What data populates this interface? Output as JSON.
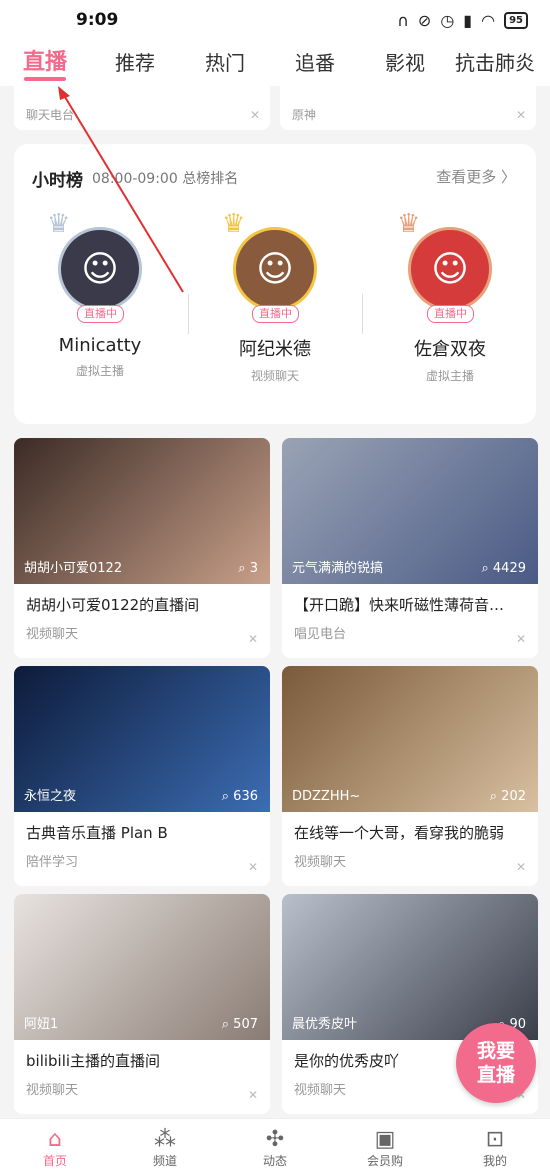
{
  "status": {
    "time": "9:09",
    "battery": "95"
  },
  "tabs": [
    {
      "label": "直播"
    },
    {
      "label": "推荐"
    },
    {
      "label": "热门"
    },
    {
      "label": "追番"
    },
    {
      "label": "影视"
    },
    {
      "label": "抗击肺炎"
    }
  ],
  "partial_cards": [
    {
      "category": "聊天电台"
    },
    {
      "category": "原神"
    }
  ],
  "rank": {
    "title": "小时榜",
    "subtitle": "08:00-09:00 总榜排名",
    "more": "查看更多 〉",
    "live_tag": "直播中",
    "rankers": [
      {
        "rank": "2",
        "name": "Minicatty",
        "category": "虚拟主播",
        "color": "#3a3a4a"
      },
      {
        "rank": "1",
        "name": "阿纪米德",
        "category": "视频聊天",
        "color": "#8a5a3c"
      },
      {
        "rank": "3",
        "name": "佐倉双夜",
        "category": "虚拟主播",
        "color": "#d63b3b"
      }
    ]
  },
  "rooms": [
    {
      "host": "胡胡小可爱0122",
      "viewers": "3",
      "title": "胡胡小可爱0122的直播间",
      "category": "视频聊天",
      "bg1": "#3b2b26",
      "bg2": "#c9a08a"
    },
    {
      "host": "元气满满的锐搞",
      "viewers": "4429",
      "title": "【开口跪】快来听磁性薄荷音…",
      "category": "唱见电台",
      "bg1": "#9aa3b5",
      "bg2": "#4a5a85"
    },
    {
      "host": "永恒之夜",
      "viewers": "636",
      "title": "古典音乐直播 Plan B",
      "category": "陪伴学习",
      "bg1": "#0d1b3a",
      "bg2": "#3c6db3"
    },
    {
      "host": "DDZZHH~",
      "viewers": "202",
      "title": "在线等一个大哥，看穿我的脆弱",
      "category": "视频聊天",
      "bg1": "#7a5a3a",
      "bg2": "#d8c0a0"
    },
    {
      "host": "阿妞1",
      "viewers": "507",
      "title": "bilibili主播的直播间",
      "category": "视频聊天",
      "bg1": "#e8e3df",
      "bg2": "#8a7c74"
    },
    {
      "host": "晨优秀皮叶",
      "viewers": "90",
      "title": "是你的优秀皮吖",
      "category": "视频聊天",
      "bg1": "#b9c0cc",
      "bg2": "#3a3f4a"
    }
  ],
  "fab": {
    "line1": "我要",
    "line2": "直播"
  },
  "bottom_nav": [
    {
      "label": "首页",
      "icon": "⌂"
    },
    {
      "label": "频道",
      "icon": "⁂"
    },
    {
      "label": "动态",
      "icon": "✣"
    },
    {
      "label": "会员购",
      "icon": "▣"
    },
    {
      "label": "我的",
      "icon": "⊡"
    }
  ]
}
